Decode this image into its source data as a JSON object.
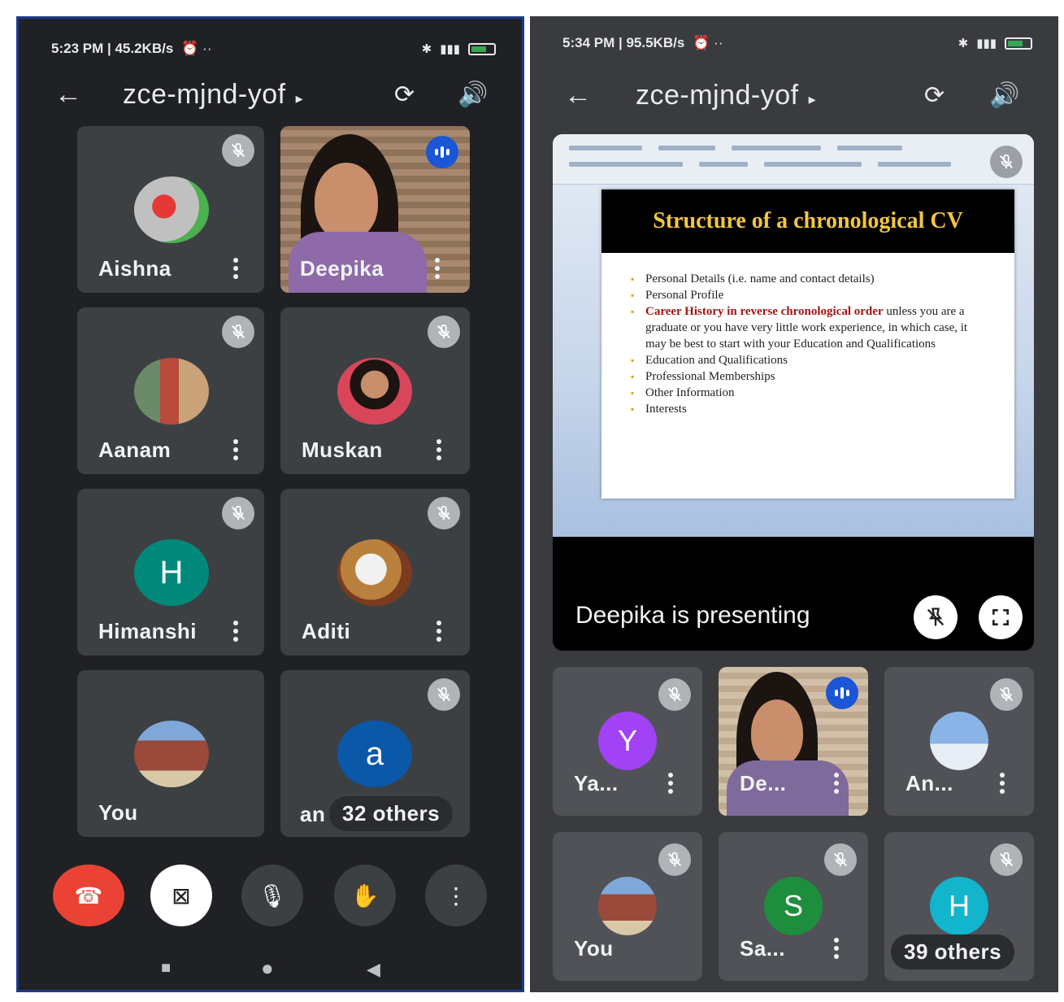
{
  "left": {
    "status": {
      "time": "5:23 PM | 45.2KB/s",
      "icons": "⏰ ··"
    },
    "meeting_code": "zce-mjnd-yof",
    "tiles": [
      {
        "name": "Aishna",
        "avatar": "race-car-photo",
        "muted": true
      },
      {
        "name": "Deepika",
        "avatar": "video",
        "speaking": true
      },
      {
        "name": "Aanam",
        "avatar": "photo",
        "muted": true
      },
      {
        "name": "Muskan",
        "avatar": "photo",
        "muted": true
      },
      {
        "name": "Himanshi",
        "avatar_letter": "H",
        "muted": true
      },
      {
        "name": "Aditi",
        "avatar": "cat-photo",
        "muted": true
      },
      {
        "name": "You",
        "avatar": "building-photo"
      },
      {
        "name": "an",
        "avatar_letter": "a",
        "muted": true,
        "others": "32 others"
      }
    ]
  },
  "right": {
    "status": {
      "time": "5:34 PM | 95.5KB/s",
      "icons": "⏰ ··"
    },
    "meeting_code": "zce-mjnd-yof",
    "slide": {
      "title": "Structure of a chronological CV",
      "bullets": [
        {
          "text": "Personal Details (i.e. name and contact details)"
        },
        {
          "text": "Personal Profile"
        },
        {
          "highlight": "Career History in reverse chronological order",
          "text": " unless you are a graduate or you have very little work experience, in which case, it may be best to start with your Education and Qualifications"
        },
        {
          "text": "Education and Qualifications"
        },
        {
          "text": "Professional Memberships"
        },
        {
          "text": "Other Information"
        },
        {
          "text": "Interests"
        }
      ]
    },
    "presenting": "Deepika is presenting",
    "tiles": [
      {
        "name": "Ya...",
        "avatar_letter": "Y",
        "muted": true
      },
      {
        "name": "De...",
        "avatar": "video",
        "speaking": true
      },
      {
        "name": "An...",
        "avatar": "photo",
        "muted": true
      },
      {
        "name": "You",
        "avatar": "building-photo",
        "muted": true
      },
      {
        "name": "Sa...",
        "avatar_letter": "S",
        "muted": true
      },
      {
        "name": "",
        "avatar_letter": "H",
        "muted": true,
        "others": "39 others"
      }
    ]
  },
  "colors": {
    "end_call": "#ea4335",
    "speaking": "#1a56d6",
    "himanshi": "#00897b",
    "a_avatar": "#0b57a8",
    "y_avatar": "#a142f4",
    "s_avatar": "#1e8e3e",
    "h_avatar_right": "#12b5cb"
  }
}
